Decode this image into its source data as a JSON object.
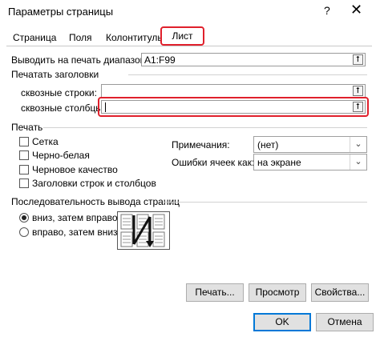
{
  "window": {
    "title": "Параметры страницы",
    "help": "?",
    "close": "✕"
  },
  "tabs": [
    {
      "label": "Страница"
    },
    {
      "label": "Поля"
    },
    {
      "label": "Колонтитулы"
    },
    {
      "label": "Лист"
    }
  ],
  "print_area": {
    "label": "Выводить на печать диапазон:",
    "value": "A1:F99"
  },
  "print_titles": {
    "section": "Печатать заголовки",
    "rows_label": "сквозные строки:",
    "rows_value": "",
    "cols_label": "сквозные столбцы:",
    "cols_value": ""
  },
  "print": {
    "section": "Печать",
    "checkboxes": [
      {
        "label": "Сетка",
        "checked": false
      },
      {
        "label": "Черно-белая",
        "checked": false
      },
      {
        "label": "Черновое качество",
        "checked": false
      },
      {
        "label": "Заголовки строк и столбцов",
        "checked": false
      }
    ],
    "comments_label": "Примечания:",
    "comments_value": "(нет)",
    "errors_label": "Ошибки ячеек как:",
    "errors_value": "на экране"
  },
  "order": {
    "section": "Последовательность вывода страниц",
    "options": [
      {
        "label": "вниз, затем вправо",
        "selected": true
      },
      {
        "label": "вправо, затем вниз",
        "selected": false
      }
    ]
  },
  "buttons": {
    "print": "Печать...",
    "preview": "Просмотр",
    "properties": "Свойства...",
    "ok": "OK",
    "cancel": "Отмена"
  },
  "icons": {
    "collapse": "⭡",
    "dropdown": "⌄"
  },
  "colors": {
    "highlight": "#e0202c",
    "accent": "#0078d7"
  }
}
